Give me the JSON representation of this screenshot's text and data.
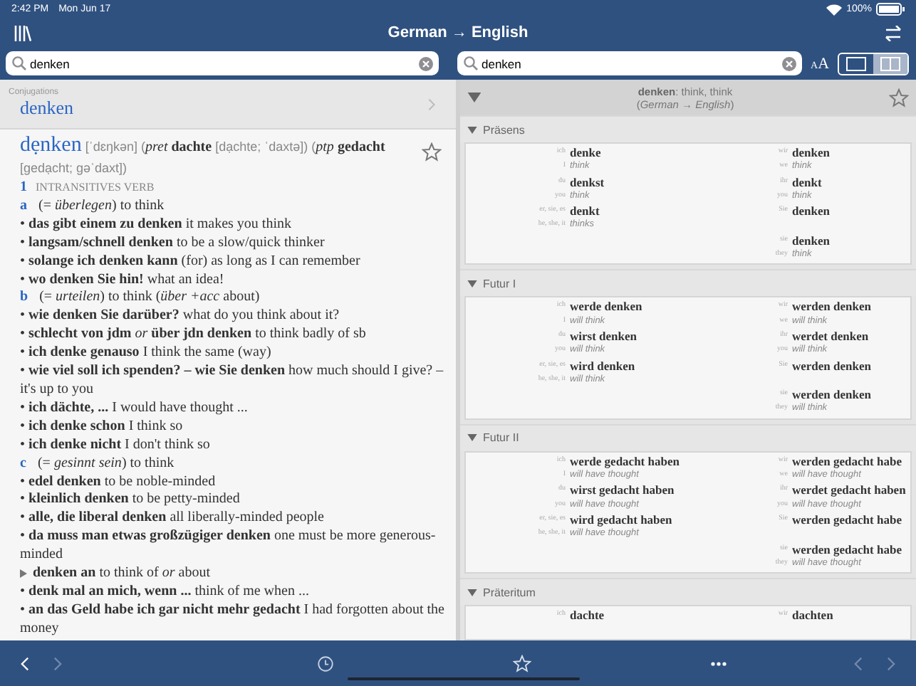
{
  "status_bar": {
    "time": "2:42 PM",
    "date": "Mon Jun 17",
    "battery": "100%"
  },
  "nav_bar": {
    "title": "German → English",
    "text_size": [
      "A",
      "A"
    ],
    "view_modes": [
      {
        "kind": "single",
        "selected": false
      },
      {
        "kind": "split",
        "selected": true
      }
    ]
  },
  "left_pane": {
    "search": {
      "value": "denken"
    },
    "conjugations": {
      "label": "Conjugations",
      "word": "denken"
    },
    "entry": {
      "headword": "dẹnken",
      "details": "[ˈdɛŋkən] (*pret* **dachte** [dạchte; ˈdaxtə]) (*ptp* **gedacht** [gedạcht; gəˈdaxt])",
      "lines": [
        {
          "kind": "sense_number",
          "number": "1",
          "text": "INTRANSITIVES VERB"
        },
        {
          "kind": "sense",
          "letter": "a",
          "text": "(= *überlegen*) to think"
        },
        {
          "kind": "example",
          "text": "• **das gibt einem zu denken** it makes you think"
        },
        {
          "kind": "example",
          "text": "• **langsam/schnell denken** to be a slow/quick thinker"
        },
        {
          "kind": "example",
          "text": "• **solange ich denken kann** (for) as long as I can remember"
        },
        {
          "kind": "example",
          "text": "• **wo denken Sie hin!** what an idea!"
        },
        {
          "kind": "sense",
          "letter": "b",
          "text": "(= *urteilen*) to think (*über +acc* about)"
        },
        {
          "kind": "example",
          "text": "• **wie denken Sie darüber?** what do you think about it?"
        },
        {
          "kind": "example",
          "text": "• **schlecht von jdm** *or* **über jdn denken** to think badly of sb"
        },
        {
          "kind": "example",
          "text": "• **ich denke genauso** I think the same (way)"
        },
        {
          "kind": "example",
          "text": "• **wie viel soll ich spenden? – wie Sie denken** how much should I give? – it's up to you"
        },
        {
          "kind": "example",
          "text": "• **ich dächte, ...** I would have thought ..."
        },
        {
          "kind": "example",
          "text": "• **ich denke schon** I think so"
        },
        {
          "kind": "example",
          "text": "• **ich denke nicht** I don't think so"
        },
        {
          "kind": "sense",
          "letter": "c",
          "text": "(= *gesinnt sein*) to think"
        },
        {
          "kind": "example",
          "text": "• **edel denken** to be noble-minded"
        },
        {
          "kind": "example",
          "text": "• **kleinlich denken** to be petty-minded"
        },
        {
          "kind": "example",
          "text": "• **alle, die liberal denken** all liberally-minded people"
        },
        {
          "kind": "example",
          "text": "• **da muss man etwas großzügiger denken** one must be more generous-minded"
        },
        {
          "kind": "phrase",
          "text": "**denken an** to think of *or* about"
        },
        {
          "kind": "example",
          "text": "• **denk mal an mich, wenn ...** think of me when ..."
        },
        {
          "kind": "example",
          "text": "• **an das Geld habe ich gar nicht mehr gedacht** I had forgotten about the money"
        }
      ]
    }
  },
  "right_pane": {
    "search": {
      "value": "denken"
    },
    "summary": {
      "expanded": true,
      "line_1": "**denken**: think, think",
      "line_2": "(*German* → *English*)"
    },
    "sections": [
      {
        "title": "Präsens",
        "expanded": true,
        "left": [
          {
            "pronoun": "ich",
            "form": "denke",
            "en_pronoun": "I",
            "en_form": "think"
          },
          {
            "pronoun": "du",
            "form": "denkst",
            "en_pronoun": "you",
            "en_form": "think"
          },
          {
            "pronoun": "er, sie, es",
            "form": "denkt",
            "en_pronoun": "he, she, it",
            "en_form": "thinks"
          }
        ],
        "right": [
          {
            "pronoun": "wir",
            "form": "denken",
            "en_pronoun": "we",
            "en_form": "think"
          },
          {
            "pronoun": "ihr",
            "form": "denkt",
            "en_pronoun": "you",
            "en_form": "think"
          },
          {
            "pronoun": "Sie",
            "form": "denken"
          },
          {
            "pronoun": "sie",
            "form": "denken",
            "en_pronoun": "they",
            "en_form": "think"
          }
        ]
      },
      {
        "title": "Futur I",
        "expanded": true,
        "left": [
          {
            "pronoun": "ich",
            "form": "werde denken",
            "en_pronoun": "I",
            "en_form": "will think"
          },
          {
            "pronoun": "du",
            "form": "wirst denken",
            "en_pronoun": "you",
            "en_form": "will think"
          },
          {
            "pronoun": "er, sie, es",
            "form": "wird denken",
            "en_pronoun": "he, she, it",
            "en_form": "will think"
          }
        ],
        "right": [
          {
            "pronoun": "wir",
            "form": "werden denken",
            "en_pronoun": "we",
            "en_form": "will think"
          },
          {
            "pronoun": "ihr",
            "form": "werdet denken",
            "en_pronoun": "you",
            "en_form": "will think"
          },
          {
            "pronoun": "Sie",
            "form": "werden denken"
          },
          {
            "pronoun": "sie",
            "form": "werden denken",
            "en_pronoun": "they",
            "en_form": "will think"
          }
        ]
      },
      {
        "title": "Futur II",
        "expanded": true,
        "left": [
          {
            "pronoun": "ich",
            "form": "werde gedacht haben",
            "en_pronoun": "I",
            "en_form": "will have thought"
          },
          {
            "pronoun": "du",
            "form": "wirst gedacht haben",
            "en_pronoun": "you",
            "en_form": "will have thought"
          },
          {
            "pronoun": "er, sie, es",
            "form": "wird gedacht haben",
            "en_pronoun": "he, she, it",
            "en_form": "will have thought"
          }
        ],
        "right": [
          {
            "pronoun": "wir",
            "form": "werden gedacht habe",
            "en_pronoun": "we",
            "en_form": "will have thought"
          },
          {
            "pronoun": "ihr",
            "form": "werdet gedacht haben",
            "en_pronoun": "you",
            "en_form": "will have thought"
          },
          {
            "pronoun": "Sie",
            "form": "werden gedacht habe"
          },
          {
            "pronoun": "sie",
            "form": "werden gedacht habe",
            "en_pronoun": "they",
            "en_form": "will have thought"
          }
        ]
      },
      {
        "title": "Präteritum",
        "expanded": true,
        "left": [
          {
            "pronoun": "ich",
            "form": "dachte"
          }
        ],
        "right": [
          {
            "pronoun": "wir",
            "form": "dachten"
          }
        ]
      }
    ]
  },
  "toolbar": {
    "left_nav": [
      {
        "kind": "back",
        "disabled": false
      },
      {
        "kind": "forward",
        "disabled": true
      }
    ],
    "right_nav": [
      {
        "kind": "back",
        "disabled": true
      },
      {
        "kind": "forward",
        "disabled": true
      }
    ]
  }
}
